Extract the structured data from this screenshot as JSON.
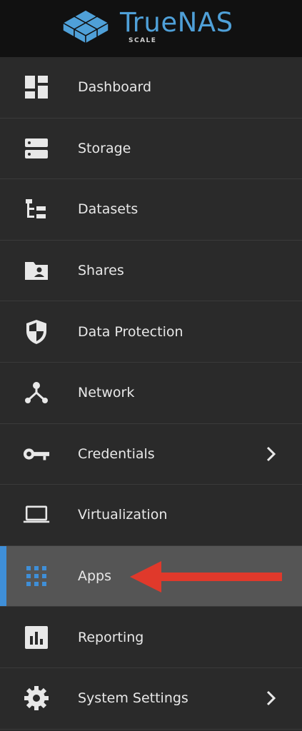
{
  "brand": {
    "name": "TrueNAS",
    "edition": "SCALE"
  },
  "nav": {
    "items": [
      {
        "label": "Dashboard",
        "icon": "dashboard-icon"
      },
      {
        "label": "Storage",
        "icon": "storage-icon"
      },
      {
        "label": "Datasets",
        "icon": "datasets-icon"
      },
      {
        "label": "Shares",
        "icon": "shares-folder-icon"
      },
      {
        "label": "Data Protection",
        "icon": "shield-icon"
      },
      {
        "label": "Network",
        "icon": "network-icon"
      },
      {
        "label": "Credentials",
        "icon": "key-icon",
        "expandable": true
      },
      {
        "label": "Virtualization",
        "icon": "laptop-icon"
      },
      {
        "label": "Apps",
        "icon": "apps-grid-icon",
        "active": true
      },
      {
        "label": "Reporting",
        "icon": "bar-chart-icon"
      },
      {
        "label": "System Settings",
        "icon": "gear-icon",
        "expandable": true
      }
    ]
  },
  "colors": {
    "accent": "#3f8fd8",
    "brand": "#4fa0d8",
    "annotation_arrow": "#e0392b",
    "active_bg": "#555555",
    "sidebar_bg": "#2a2a2a",
    "topbar_bg": "#111111"
  }
}
